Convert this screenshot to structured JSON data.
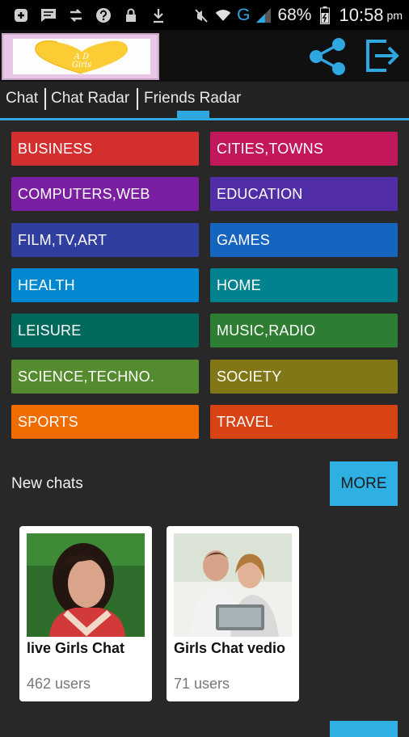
{
  "status_bar": {
    "battery": "68%",
    "time": "10:58",
    "ampm": "pm",
    "network": "G",
    "icons": [
      "notification-icon",
      "message-icon",
      "sync-icon",
      "help-icon",
      "lock-icon",
      "download-icon",
      "mute-icon",
      "wifi-icon",
      "signal-icon",
      "battery-icon"
    ]
  },
  "app_bar": {
    "logo_text": "A D Girls",
    "actions": [
      "share-icon",
      "exit-icon"
    ]
  },
  "tabs": [
    {
      "label": "Chat"
    },
    {
      "label": "Chat Radar"
    },
    {
      "label": "Friends Radar"
    }
  ],
  "categories": [
    {
      "label": "BUSINESS",
      "color": "#d32f2f"
    },
    {
      "label": "CITIES,TOWNS",
      "color": "#c2185b"
    },
    {
      "label": "COMPUTERS,WEB",
      "color": "#7b1fa2"
    },
    {
      "label": "EDUCATION",
      "color": "#512da8"
    },
    {
      "label": "FILM,TV,ART",
      "color": "#303f9f"
    },
    {
      "label": "GAMES",
      "color": "#1565c0"
    },
    {
      "label": "HEALTH",
      "color": "#0288d1"
    },
    {
      "label": "HOME",
      "color": "#00838f"
    },
    {
      "label": "LEISURE",
      "color": "#00695c"
    },
    {
      "label": "MUSIC,RADIO",
      "color": "#2e7d32"
    },
    {
      "label": "SCIENCE,TECHNO.",
      "color": "#558b2f"
    },
    {
      "label": "SOCIETY",
      "color": "#827717"
    },
    {
      "label": "SPORTS",
      "color": "#ef6c00"
    },
    {
      "label": "TRAVEL",
      "color": "#d84315"
    }
  ],
  "new_chats": {
    "title": "New chats",
    "more_label": "MORE",
    "items": [
      {
        "name": "live Girls Chat",
        "users": "462 users"
      },
      {
        "name": "Girls Chat vedio",
        "users": "71 users"
      }
    ]
  }
}
